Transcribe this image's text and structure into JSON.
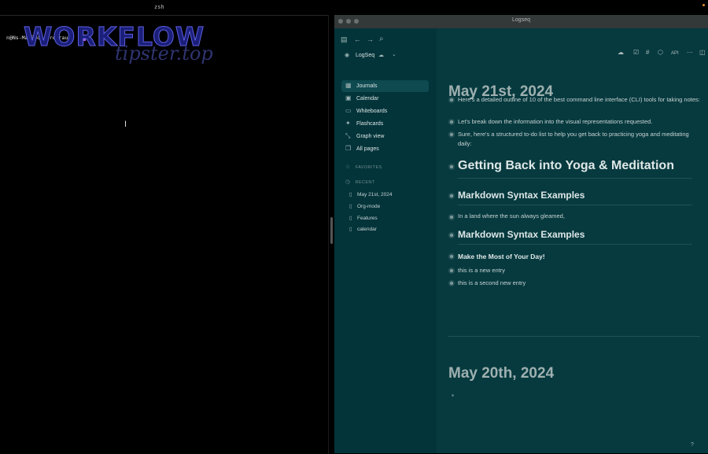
{
  "terminal": {
    "tab_label": "zsh",
    "prompt": "n@Ns-MacBook-Pro rau %"
  },
  "watermark": {
    "title": "WORKFLOW",
    "subtitle": "tipster.top"
  },
  "logseq": {
    "window_title": "Logseq",
    "header": {
      "api_label": "API"
    },
    "graph": {
      "name": "LogSeq"
    },
    "nav": [
      {
        "label": "Journals",
        "icon": "calendar-icon"
      },
      {
        "label": "Calendar",
        "icon": "calendar-grid-icon"
      },
      {
        "label": "Whiteboards",
        "icon": "whiteboard-icon"
      },
      {
        "label": "Flashcards",
        "icon": "flashcards-icon"
      },
      {
        "label": "Graph view",
        "icon": "graph-icon"
      },
      {
        "label": "All pages",
        "icon": "pages-icon"
      }
    ],
    "favorites_label": "FAVORITES",
    "recent_label": "RECENT",
    "recent": [
      "May 21st, 2024",
      "Org-mode",
      "Features",
      "calendar"
    ],
    "journals": [
      {
        "date": "May 21st, 2024",
        "blocks": [
          "Here's a detailed outline of 10 of the best command line interface (CLI) tools for taking notes:",
          "Let's break down the information into the visual representations requested.",
          "Sure, here's a structured to-do list to help you get back to practicing yoga and meditating daily:",
          "Getting Back into Yoga & Meditation",
          "Markdown Syntax Examples",
          "In a land where the sun always gleamed,",
          "Markdown Syntax Examples",
          "Make the Most of Your Day!",
          "this is a new entry",
          "this is a second new entry"
        ]
      },
      {
        "date": "May 20th, 2024",
        "blocks": []
      }
    ],
    "help_label": "?"
  },
  "colors": {
    "sidebar_bg": "#02343a",
    "main_bg": "#063a3f",
    "cursor": "#b85cf0"
  }
}
